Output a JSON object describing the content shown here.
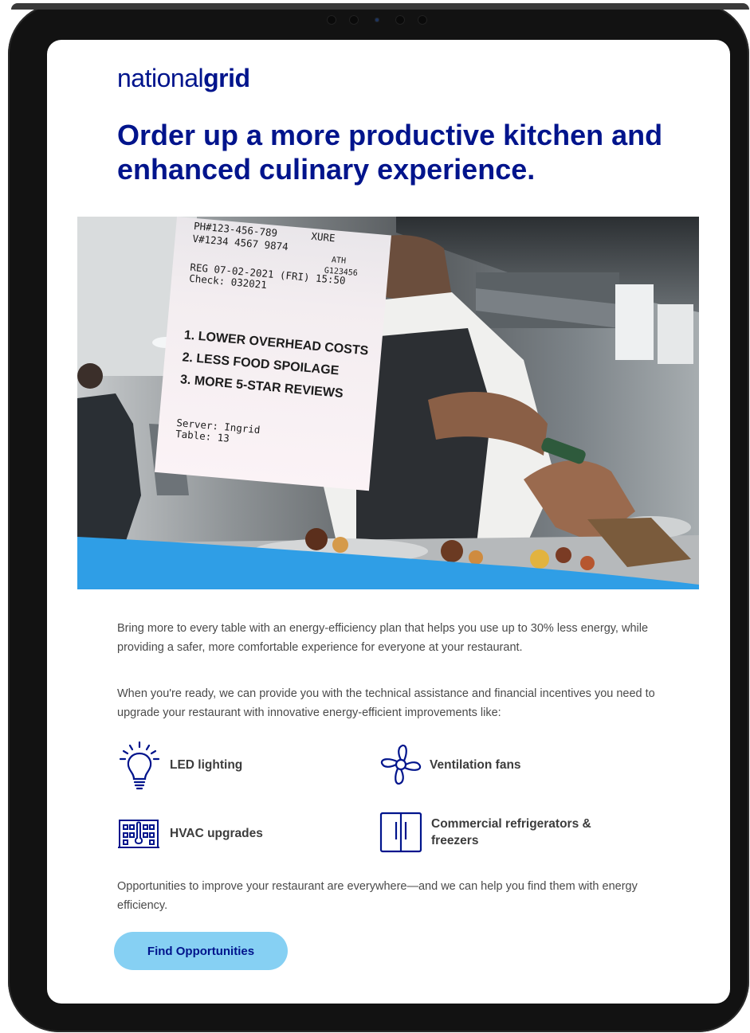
{
  "brand": {
    "name_light": "national",
    "name_bold": "grid"
  },
  "headline": "Order up a more productive kitchen and enhanced culinary experience.",
  "hero": {
    "receipt": {
      "header_lines": [
        "PH#123-456-789",
        "V#1234 4567 9874",
        "REG 07-02-2021 (FRI) 15:50",
        "Check: 032021"
      ],
      "header_right": [
        "ATH",
        "G123456"
      ],
      "header_top_right": "XURE",
      "items": [
        "1. LOWER OVERHEAD COSTS",
        "2. LESS FOOD SPOILAGE",
        "3. MORE 5-STAR REVIEWS"
      ],
      "footer_lines": [
        "Server: Ingrid",
        "Table: 13"
      ]
    }
  },
  "body": {
    "paragraph1": "Bring more to every table with an energy-efficiency plan that helps you use up to 30% less energy, while providing a safer, more comfortable experience for everyone at your restaurant.",
    "paragraph2": "When you're ready, we can provide you with the technical assistance and financial incentives you need to upgrade your restaurant with innovative energy-efficient improvements like:",
    "paragraph3": "Opportunities to improve your restaurant are everywhere—and we can help you find them with energy efficiency."
  },
  "features": [
    {
      "label": "LED lighting",
      "icon": "lightbulb-icon"
    },
    {
      "label": "Ventilation fans",
      "icon": "fan-icon"
    },
    {
      "label": "HVAC upgrades",
      "icon": "building-thermometer-icon"
    },
    {
      "label_line1": "Commercial refrigerators &",
      "label_line2": "freezers",
      "icon": "refrigerator-icon"
    }
  ],
  "cta": {
    "label": "Find Opportunities"
  },
  "colors": {
    "brand_navy": "#00148c",
    "cta_bg": "#86d0f3",
    "band_blue": "#2f9ee6",
    "body_text": "#4a4a4a"
  }
}
